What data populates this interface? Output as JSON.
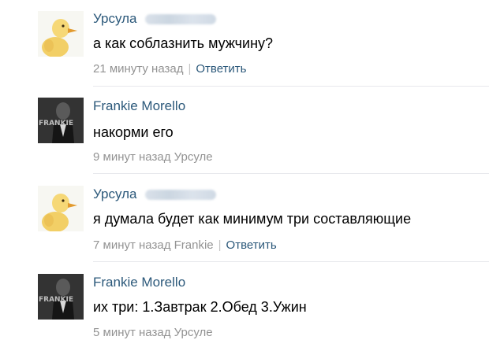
{
  "colors": {
    "author": "#2b587a",
    "meta": "#939393",
    "reply_link": "#2b587a",
    "divider": "#e7e8ec"
  },
  "comments": [
    {
      "author": "Урсула",
      "avatar_icon": "duckling-avatar-icon",
      "text": "а как соблазнить мужчину?",
      "time": "21 минуту назад",
      "separator": "|",
      "reply_label": "Ответить"
    },
    {
      "author": "Frankie Morello",
      "avatar_icon": "frankie-avatar-icon",
      "text": "накорми его",
      "time": "9 минут назад Урсуле"
    },
    {
      "author": "Урсула",
      "avatar_icon": "duckling-avatar-icon",
      "text": "я думала будет как минимум три составляющие",
      "time": "7 минут назад Frankie",
      "separator": "|",
      "reply_label": "Ответить"
    },
    {
      "author": "Frankie Morello",
      "avatar_icon": "frankie-avatar-icon",
      "text": "их три: 1.Завтрак 2.Обед 3.Ужин",
      "time": "5 минут назад Урсуле"
    }
  ],
  "avatar_overlay_text": "FRANKIE"
}
